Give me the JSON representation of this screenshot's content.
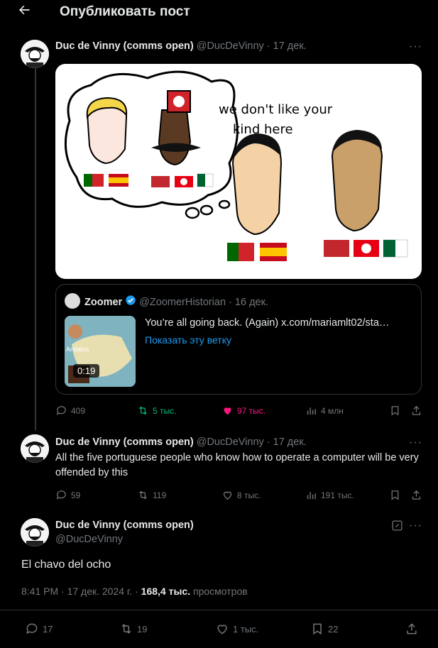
{
  "header": {
    "title": "Опубликовать пост"
  },
  "author": {
    "name": "Duc de Vinny (comms open)",
    "handle": "@DucDeVinny"
  },
  "tweet1": {
    "date": "· 17 дек.",
    "meme_text_line1": "we don't like your",
    "meme_text_line2": "kind here",
    "quote": {
      "name": "Zoomer",
      "handle": "@ZoomerHistorian",
      "date": "· 16 дек.",
      "text": "You’re all going back. (Again)  x.com/mariamlt02/sta…",
      "link": "Показать эту ветку",
      "duration": "0:19",
      "thumb_label": "Andalus"
    },
    "actions": {
      "replies": "409",
      "retweets": "5 тыс.",
      "likes": "97 тыс.",
      "views": "4 млн"
    }
  },
  "tweet2": {
    "date": "· 17 дек.",
    "text": "All the five portuguese people who know how to operate a computer will be very offended by this",
    "actions": {
      "replies": "59",
      "retweets": "119",
      "likes": "8 тыс.",
      "views": "191 тыс."
    }
  },
  "main": {
    "text": "El chavo del ocho",
    "time": "8:41 PM · 17 дек. 2024 г. · ",
    "views_count": "168,4 тыс.",
    "views_label": " просмотров",
    "actions": {
      "replies": "17",
      "retweets": "19",
      "likes": "1 тыс.",
      "bookmarks": "22"
    }
  },
  "colors": {
    "accent": "#1d9bf0",
    "retweet": "#00ba7c",
    "like": "#f91880",
    "muted": "#71767b"
  },
  "icons": [
    "back-arrow-icon",
    "more-icon",
    "reply-icon",
    "retweet-icon",
    "like-icon",
    "views-icon",
    "bookmark-icon",
    "share-icon",
    "verified-icon",
    "edit-icon"
  ]
}
